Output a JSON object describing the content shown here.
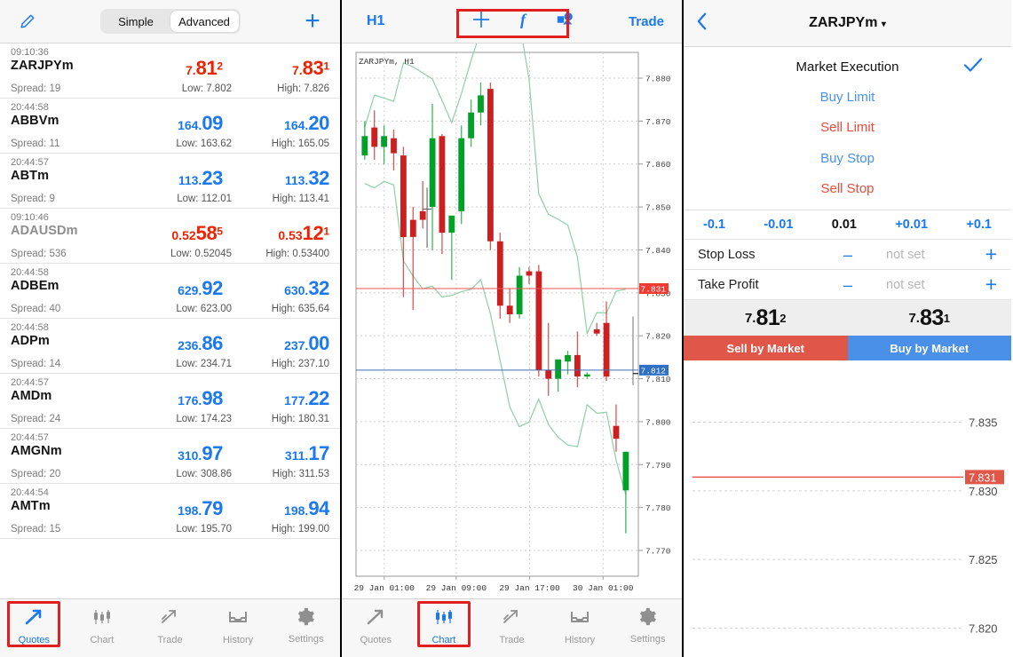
{
  "quotes": {
    "edit_icon": "pencil-icon",
    "add_icon": "plus-icon",
    "modes": [
      {
        "label": "Simple",
        "active": false
      },
      {
        "label": "Advanced",
        "active": true
      }
    ],
    "rows": [
      {
        "time": "09:10:36",
        "symbol": "ZARJPYm",
        "dim": false,
        "spread": "Spread: 19",
        "bid": {
          "pre": "7.",
          "big": "81",
          "sup": "2",
          "dir": "down"
        },
        "ask": {
          "pre": "7.",
          "big": "83",
          "sup": "1",
          "dir": "down"
        },
        "low": "Low: 7.802",
        "high": "High: 7.826"
      },
      {
        "time": "20:44:58",
        "symbol": "ABBVm",
        "dim": false,
        "spread": "Spread: 11",
        "bid": {
          "pre": "164.",
          "big": "09",
          "sup": "",
          "dir": "up"
        },
        "ask": {
          "pre": "164.",
          "big": "20",
          "sup": "",
          "dir": "up"
        },
        "low": "Low: 163.62",
        "high": "High: 165.05"
      },
      {
        "time": "20:44:57",
        "symbol": "ABTm",
        "dim": false,
        "spread": "Spread: 9",
        "bid": {
          "pre": "113.",
          "big": "23",
          "sup": "",
          "dir": "up"
        },
        "ask": {
          "pre": "113.",
          "big": "32",
          "sup": "",
          "dir": "up"
        },
        "low": "Low: 112.01",
        "high": "High: 113.41"
      },
      {
        "time": "09:10:46",
        "symbol": "ADAUSDm",
        "dim": true,
        "spread": "Spread: 536",
        "bid": {
          "pre": "0.52",
          "big": "58",
          "sup": "5",
          "dir": "down"
        },
        "ask": {
          "pre": "0.53",
          "big": "12",
          "sup": "1",
          "dir": "down"
        },
        "low": "Low: 0.52045",
        "high": "High: 0.53400"
      },
      {
        "time": "20:44:58",
        "symbol": "ADBEm",
        "dim": false,
        "spread": "Spread: 40",
        "bid": {
          "pre": "629.",
          "big": "92",
          "sup": "",
          "dir": "up"
        },
        "ask": {
          "pre": "630.",
          "big": "32",
          "sup": "",
          "dir": "up"
        },
        "low": "Low: 623.00",
        "high": "High: 635.64"
      },
      {
        "time": "20:44:58",
        "symbol": "ADPm",
        "dim": false,
        "spread": "Spread: 14",
        "bid": {
          "pre": "236.",
          "big": "86",
          "sup": "",
          "dir": "up"
        },
        "ask": {
          "pre": "237.",
          "big": "00",
          "sup": "",
          "dir": "up"
        },
        "low": "Low: 234.71",
        "high": "High: 237.10"
      },
      {
        "time": "20:44:57",
        "symbol": "AMDm",
        "dim": false,
        "spread": "Spread: 24",
        "bid": {
          "pre": "176.",
          "big": "98",
          "sup": "",
          "dir": "up"
        },
        "ask": {
          "pre": "177.",
          "big": "22",
          "sup": "",
          "dir": "up"
        },
        "low": "Low: 174.23",
        "high": "High: 180.31"
      },
      {
        "time": "20:44:57",
        "symbol": "AMGNm",
        "dim": false,
        "spread": "Spread: 20",
        "bid": {
          "pre": "310.",
          "big": "97",
          "sup": "",
          "dir": "up"
        },
        "ask": {
          "pre": "311.",
          "big": "17",
          "sup": "",
          "dir": "up"
        },
        "low": "Low: 308.86",
        "high": "High: 311.53"
      },
      {
        "time": "20:44:54",
        "symbol": "AMTm",
        "dim": false,
        "spread": "Spread: 15",
        "bid": {
          "pre": "198.",
          "big": "79",
          "sup": "",
          "dir": "up"
        },
        "ask": {
          "pre": "198.",
          "big": "94",
          "sup": "",
          "dir": "up"
        },
        "low": "Low: 195.70",
        "high": "High: 199.00"
      }
    ]
  },
  "tabbar": {
    "items": [
      {
        "label": "Quotes",
        "icon": "arrow-trend-icon"
      },
      {
        "label": "Chart",
        "icon": "candlestick-icon"
      },
      {
        "label": "Trade",
        "icon": "line-trend-icon"
      },
      {
        "label": "History",
        "icon": "inbox-icon"
      },
      {
        "label": "Settings",
        "icon": "gear-icon"
      }
    ],
    "panel1_active": "Quotes",
    "panel2_active": "Chart"
  },
  "chart": {
    "timeframe": "H1",
    "trade_label": "Trade",
    "tools": [
      {
        "name": "crosshair-icon"
      },
      {
        "name": "function-f-icon"
      },
      {
        "name": "objects-icon"
      }
    ],
    "watermark": "ZARJPYm, H1",
    "colors": {
      "bid_line": "#ef5350",
      "ask_line": "#3b6fb5",
      "bull": "#00a029",
      "bear": "#cc2020",
      "band": "#8fcfa5"
    },
    "chart_data": {
      "type": "candlestick",
      "title": "ZARJPYm, H1",
      "ylabel": "",
      "xlabel": "",
      "ylim": [
        7.764,
        7.886
      ],
      "y_ticks": [
        "7.880",
        "7.870",
        "7.860",
        "7.850",
        "7.840",
        "7.830",
        "7.820",
        "7.810",
        "7.800",
        "7.790",
        "7.780",
        "7.770"
      ],
      "x_ticks": [
        "29 Jan 01:00",
        "29 Jan 09:00",
        "29 Jan 17:00",
        "30 Jan 01:00"
      ],
      "bid_price": "7.831",
      "ask_price": "7.812",
      "candles": [
        {
          "o": 7.8665,
          "h": 7.87,
          "l": 7.861,
          "c": 7.862,
          "d": "up"
        },
        {
          "o": 7.864,
          "h": 7.8725,
          "l": 7.861,
          "c": 7.8685,
          "d": "down"
        },
        {
          "o": 7.864,
          "h": 7.869,
          "l": 7.86,
          "c": 7.8665,
          "d": "up"
        },
        {
          "o": 7.866,
          "h": 7.868,
          "l": 7.8585,
          "c": 7.8625,
          "d": "down"
        },
        {
          "o": 7.862,
          "h": 7.864,
          "l": 7.829,
          "c": 7.843,
          "d": "down"
        },
        {
          "o": 7.843,
          "h": 7.85,
          "l": 7.826,
          "c": 7.847,
          "d": "down"
        },
        {
          "o": 7.847,
          "h": 7.856,
          "l": 7.845,
          "c": 7.849,
          "d": "down"
        },
        {
          "o": 7.85,
          "h": 7.874,
          "l": 7.84,
          "c": 7.866,
          "d": "up"
        },
        {
          "o": 7.8665,
          "h": 7.867,
          "l": 7.839,
          "c": 7.844,
          "d": "down"
        },
        {
          "o": 7.844,
          "h": 7.847,
          "l": 7.833,
          "c": 7.848,
          "d": "up"
        },
        {
          "o": 7.849,
          "h": 7.869,
          "l": 7.846,
          "c": 7.866,
          "d": "up"
        },
        {
          "o": 7.866,
          "h": 7.875,
          "l": 7.864,
          "c": 7.872,
          "d": "up"
        },
        {
          "o": 7.872,
          "h": 7.879,
          "l": 7.869,
          "c": 7.876,
          "d": "up"
        },
        {
          "o": 7.8775,
          "h": 7.879,
          "l": 7.84,
          "c": 7.842,
          "d": "down"
        },
        {
          "o": 7.842,
          "h": 7.844,
          "l": 7.824,
          "c": 7.827,
          "d": "down"
        },
        {
          "o": 7.827,
          "h": 7.831,
          "l": 7.823,
          "c": 7.825,
          "d": "down"
        },
        {
          "o": 7.825,
          "h": 7.836,
          "l": 7.824,
          "c": 7.834,
          "d": "up"
        },
        {
          "o": 7.834,
          "h": 7.836,
          "l": 7.832,
          "c": 7.835,
          "d": "down"
        },
        {
          "o": 7.835,
          "h": 7.8365,
          "l": 7.8105,
          "c": 7.812,
          "d": "down"
        },
        {
          "o": 7.812,
          "h": 7.823,
          "l": 7.806,
          "c": 7.81,
          "d": "down"
        },
        {
          "o": 7.81,
          "h": 7.812,
          "l": 7.807,
          "c": 7.8145,
          "d": "up"
        },
        {
          "o": 7.814,
          "h": 7.8165,
          "l": 7.811,
          "c": 7.8155,
          "d": "up"
        },
        {
          "o": 7.8155,
          "h": 7.821,
          "l": 7.808,
          "c": 7.8105,
          "d": "down"
        },
        {
          "o": 7.8105,
          "h": 7.8115,
          "l": 7.81,
          "c": 7.811,
          "d": "up"
        },
        {
          "o": 7.8215,
          "h": 7.823,
          "l": 7.82,
          "c": 7.8205,
          "d": "down"
        },
        {
          "o": 7.823,
          "h": 7.828,
          "l": 7.8095,
          "c": 7.8105,
          "d": "down"
        },
        {
          "o": 7.799,
          "h": 7.804,
          "l": 7.793,
          "c": 7.796,
          "d": "down"
        },
        {
          "o": 7.784,
          "h": 7.793,
          "l": 7.774,
          "c": 7.793,
          "d": "up"
        }
      ]
    }
  },
  "trade": {
    "back_icon": "chevron-left-icon",
    "symbol": "ZARJPYm",
    "caret": "▾",
    "execution_label": "Market Execution",
    "check_icon": "check-icon",
    "options": [
      {
        "label": "Buy Limit",
        "kind": "buy"
      },
      {
        "label": "Sell Limit",
        "kind": "sell"
      },
      {
        "label": "Buy Stop",
        "kind": "buy"
      },
      {
        "label": "Sell Stop",
        "kind": "sell"
      }
    ],
    "steppers": [
      {
        "label": "-0.1",
        "active": true
      },
      {
        "label": "-0.01",
        "active": true
      },
      {
        "label": "0.01",
        "active": false
      },
      {
        "label": "+0.01",
        "active": true
      },
      {
        "label": "+0.1",
        "active": true
      }
    ],
    "fields": [
      {
        "label": "Stop Loss",
        "minus": "–",
        "value": "not set",
        "plus": "+"
      },
      {
        "label": "Take Profit",
        "minus": "–",
        "value": "not set",
        "plus": "+"
      }
    ],
    "bid": {
      "pre": "7.",
      "big": "81",
      "sup": "2"
    },
    "ask": {
      "pre": "7.",
      "big": "83",
      "sup": "1"
    },
    "sell_button": "Sell by Market",
    "buy_button": "Buy by Market",
    "mini_chart": {
      "type": "line",
      "y_ticks": [
        "7.835",
        "7.830",
        "7.825",
        "7.820"
      ],
      "price_line": "7.831",
      "price_color": "#ef5350"
    }
  }
}
